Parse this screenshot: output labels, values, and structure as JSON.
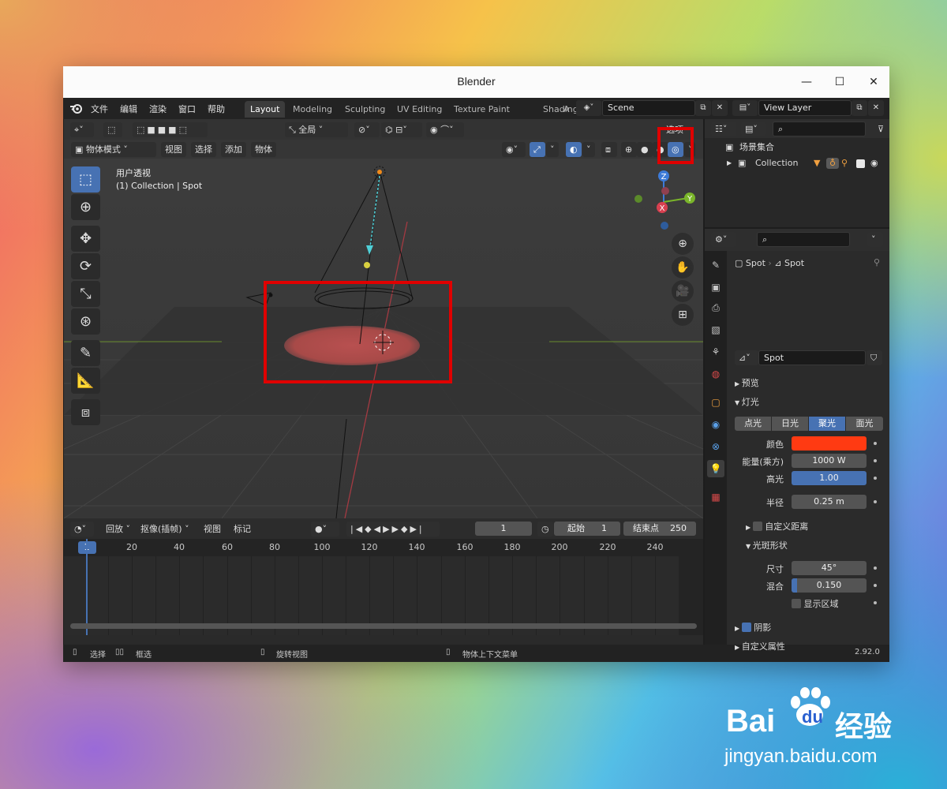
{
  "window": {
    "title": "Blender",
    "minimize": "—",
    "maximize": "☐",
    "close": "✕"
  },
  "topbar": {
    "menus": [
      "文件",
      "编辑",
      "渲染",
      "窗口",
      "帮助"
    ],
    "workspaces": [
      "Layout",
      "Modeling",
      "Sculpting",
      "UV Editing",
      "Texture Paint",
      "Shading",
      "A"
    ],
    "active_workspace": "Layout",
    "scene_name": "Scene",
    "view_layer": "View Layer"
  },
  "viewport": {
    "transform_orientation": "全局",
    "mode": "物体模式",
    "menus": [
      "视图",
      "选择",
      "添加",
      "物体"
    ],
    "options_label": "选项",
    "overlay_text_1": "用户透视",
    "overlay_text_2": "(1) Collection | Spot",
    "gizmo": {
      "z": "Z",
      "y": "Y",
      "x": "X"
    }
  },
  "timeline": {
    "menus": [
      "回放",
      "抠像(插帧)",
      "视图",
      "标记"
    ],
    "current_frame": "1",
    "start_label": "起始",
    "start": "1",
    "end_label": "结束点",
    "end": "250",
    "ruler": [
      "1",
      "20",
      "40",
      "60",
      "80",
      "100",
      "120",
      "140",
      "160",
      "180",
      "200",
      "220",
      "240"
    ]
  },
  "statusbar": {
    "select": "选择",
    "box_select": "框选",
    "rotate_view": "旋转视图",
    "context_menu": "物体上下文菜单",
    "version": "2.92.0"
  },
  "outliner": {
    "scene_collection": "场景集合",
    "collection": "Collection"
  },
  "properties": {
    "breadcrumb_object": "Spot",
    "breadcrumb_data": "Spot",
    "data_name": "Spot",
    "preview_panel": "预览",
    "light_panel": "灯光",
    "light_types": [
      "点光",
      "日光",
      "聚光",
      "面光"
    ],
    "active_light_type": "聚光",
    "color_label": "颜色",
    "color_value": "#ff3a12",
    "power_label": "能量(乘方)",
    "power_value": "1000 W",
    "specular_label": "高光",
    "specular_value": "1.00",
    "radius_label": "半径",
    "radius_value": "0.25 m",
    "custom_distance": "自定义距离",
    "spot_shape_panel": "光斑形状",
    "size_label": "尺寸",
    "size_value": "45°",
    "blend_label": "混合",
    "blend_value": "0.150",
    "blend_fraction": 0.15,
    "show_cone": "显示区域",
    "shadow_panel": "阴影",
    "custom_props_panel": "自定义属性"
  },
  "watermark": {
    "brand": "Bai",
    "brand2": "du",
    "cn": "经验",
    "url": "jingyan.baidu.com"
  },
  "colors": {
    "accent": "#4772b3",
    "highlight_red": "#e00000"
  }
}
